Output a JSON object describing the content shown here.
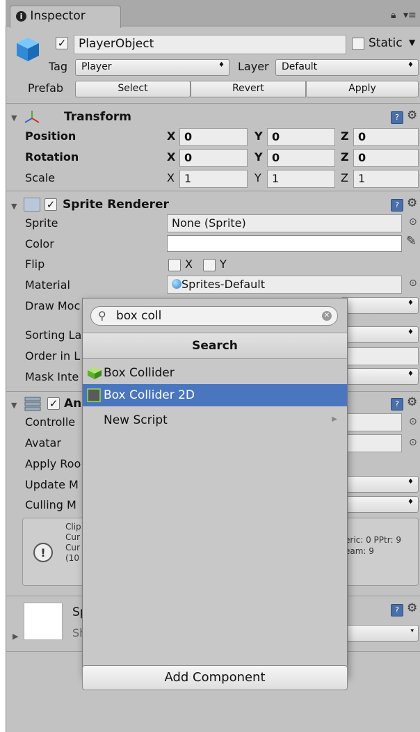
{
  "tab": {
    "title": "Inspector"
  },
  "object": {
    "name": "PlayerObject",
    "static_label": "Static",
    "tag_label": "Tag",
    "tag_value": "Player",
    "layer_label": "Layer",
    "layer_value": "Default",
    "prefab_label": "Prefab",
    "select_label": "Select",
    "revert_label": "Revert",
    "apply_label": "Apply"
  },
  "transform": {
    "title": "Transform",
    "rows": [
      {
        "label": "Position",
        "x": "0",
        "y": "0",
        "z": "0"
      },
      {
        "label": "Rotation",
        "x": "0",
        "y": "0",
        "z": "0"
      },
      {
        "label": "Scale",
        "x": "1",
        "y": "1",
        "z": "1"
      }
    ],
    "axis": {
      "x": "X",
      "y": "Y",
      "z": "Z"
    }
  },
  "sprite_renderer": {
    "title": "Sprite Renderer",
    "sprite_label": "Sprite",
    "sprite_value": "None (Sprite)",
    "color_label": "Color",
    "flip_label": "Flip",
    "flip_x": "X",
    "flip_y": "Y",
    "material_label": "Material",
    "material_value": "Sprites-Default",
    "draw_mode_label": "Draw Moc",
    "sorting_label": "Sorting La",
    "order_label": "Order in L",
    "mask_label": "Mask Inte"
  },
  "animator": {
    "title": "An",
    "controller_label": "Controlle",
    "avatar_label": "Avatar",
    "apply_root_label": "Apply Roo",
    "update_label": "Update M",
    "culling_label": "Culling M",
    "info_lines": [
      "Clip",
      "Cur",
      "Cur",
      "(10"
    ],
    "info_right_1": "eric: 0 PPtr: 9",
    "info_right_2": "eam: 9"
  },
  "sprite_asset": {
    "title": "Sp",
    "subtitle": "Sh"
  },
  "popup": {
    "search_value": "box coll",
    "header": "Search",
    "items": [
      {
        "label": "Box Collider",
        "selected": false
      },
      {
        "label": "Box Collider 2D",
        "selected": true
      },
      {
        "label": "New Script",
        "selected": false,
        "submenu": true
      }
    ]
  },
  "add_component": {
    "label": "Add Component"
  },
  "colors": {
    "panel_bg": "#c2c2c2",
    "selection": "#4a76c0",
    "help_icon": "#4a6ea8"
  }
}
